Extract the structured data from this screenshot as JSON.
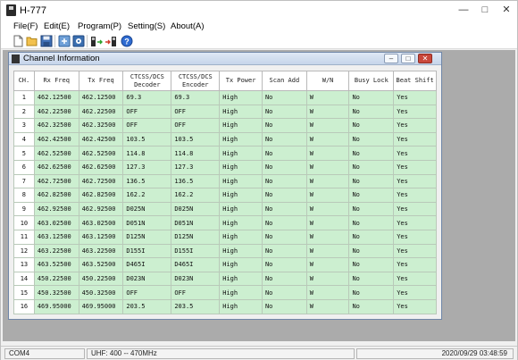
{
  "window": {
    "title": "H-777"
  },
  "menu": [
    "File(F)",
    "Edit(E)",
    "Program(P)",
    "Setting(S)",
    "About(A)"
  ],
  "toolbar_icons": [
    "new-file-icon",
    "open-folder-icon",
    "save-icon",
    "read-radio-icon",
    "settings-icon",
    "read-from-radio-icon",
    "write-to-radio-icon",
    "help-icon"
  ],
  "child": {
    "title": "Channel Information"
  },
  "table": {
    "headers": [
      "CH.",
      "Rx Freq",
      "Tx Freq",
      "CTCSS/DCS\nDecoder",
      "CTCSS/DCS\nEncoder",
      "Tx Power",
      "Scan Add",
      "W/N",
      "Busy Lock",
      "Beat Shift"
    ],
    "rows": [
      [
        "1",
        "462.12500",
        "462.12500",
        "69.3",
        "69.3",
        "High",
        "No",
        "W",
        "No",
        "Yes"
      ],
      [
        "2",
        "462.22500",
        "462.22500",
        "OFF",
        "OFF",
        "High",
        "No",
        "W",
        "No",
        "Yes"
      ],
      [
        "3",
        "462.32500",
        "462.32500",
        "OFF",
        "OFF",
        "High",
        "No",
        "W",
        "No",
        "Yes"
      ],
      [
        "4",
        "462.42500",
        "462.42500",
        "103.5",
        "103.5",
        "High",
        "No",
        "W",
        "No",
        "Yes"
      ],
      [
        "5",
        "462.52500",
        "462.52500",
        "114.8",
        "114.8",
        "High",
        "No",
        "W",
        "No",
        "Yes"
      ],
      [
        "6",
        "462.62500",
        "462.62500",
        "127.3",
        "127.3",
        "High",
        "No",
        "W",
        "No",
        "Yes"
      ],
      [
        "7",
        "462.72500",
        "462.72500",
        "136.5",
        "136.5",
        "High",
        "No",
        "W",
        "No",
        "Yes"
      ],
      [
        "8",
        "462.82500",
        "462.82500",
        "162.2",
        "162.2",
        "High",
        "No",
        "W",
        "No",
        "Yes"
      ],
      [
        "9",
        "462.92500",
        "462.92500",
        "D025N",
        "D025N",
        "High",
        "No",
        "W",
        "No",
        "Yes"
      ],
      [
        "10",
        "463.02500",
        "463.02500",
        "D051N",
        "D051N",
        "High",
        "No",
        "W",
        "No",
        "Yes"
      ],
      [
        "11",
        "463.12500",
        "463.12500",
        "D125N",
        "D125N",
        "High",
        "No",
        "W",
        "No",
        "Yes"
      ],
      [
        "12",
        "463.22500",
        "463.22500",
        "D155I",
        "D155I",
        "High",
        "No",
        "W",
        "No",
        "Yes"
      ],
      [
        "13",
        "463.52500",
        "463.52500",
        "D465I",
        "D465I",
        "High",
        "No",
        "W",
        "No",
        "Yes"
      ],
      [
        "14",
        "450.22500",
        "450.22500",
        "D023N",
        "D023N",
        "High",
        "No",
        "W",
        "No",
        "Yes"
      ],
      [
        "15",
        "450.32500",
        "450.32500",
        "OFF",
        "OFF",
        "High",
        "No",
        "W",
        "No",
        "Yes"
      ],
      [
        "16",
        "469.95000",
        "469.95000",
        "203.5",
        "203.5",
        "High",
        "No",
        "W",
        "No",
        "Yes"
      ]
    ]
  },
  "status": {
    "port": "COM4",
    "band": "UHF: 400 -- 470MHz",
    "datetime": "2020/09/29 03:48:59"
  }
}
